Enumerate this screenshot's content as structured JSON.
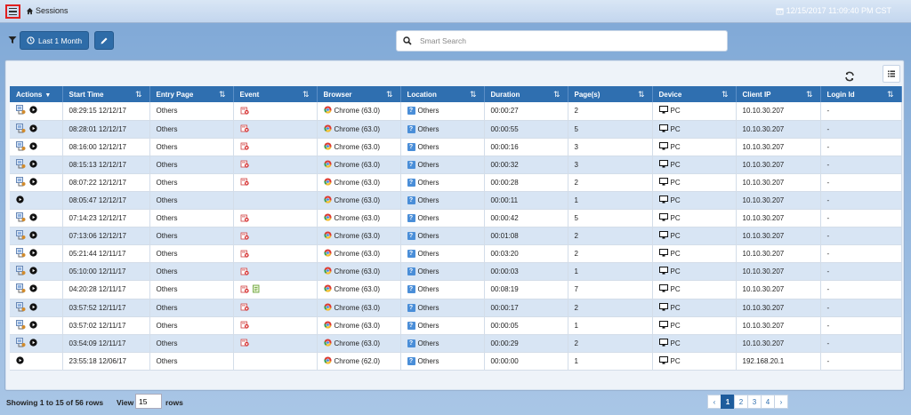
{
  "header": {
    "breadcrumb": "Sessions",
    "datetime": "12/15/2017 11:09:40 PM CST"
  },
  "toolbar": {
    "range_label": "Last 1 Month",
    "search_placeholder": "Smart Search"
  },
  "table": {
    "columns": [
      "Actions",
      "Start Time",
      "Entry Page",
      "Event",
      "Browser",
      "Location",
      "Duration",
      "Page(s)",
      "Device",
      "Client IP",
      "Login Id"
    ],
    "rows": [
      {
        "replay": true,
        "start": "08:29:15 12/12/17",
        "entry": "Others",
        "events": [
          "error"
        ],
        "browser": "Chrome (63.0)",
        "location": "Others",
        "duration": "00:00:27",
        "pages": "2",
        "device": "PC",
        "ip": "10.10.30.207",
        "login": "-"
      },
      {
        "replay": true,
        "start": "08:28:01 12/12/17",
        "entry": "Others",
        "events": [
          "error"
        ],
        "browser": "Chrome (63.0)",
        "location": "Others",
        "duration": "00:00:55",
        "pages": "5",
        "device": "PC",
        "ip": "10.10.30.207",
        "login": "-"
      },
      {
        "replay": true,
        "start": "08:16:00 12/12/17",
        "entry": "Others",
        "events": [
          "error"
        ],
        "browser": "Chrome (63.0)",
        "location": "Others",
        "duration": "00:00:16",
        "pages": "3",
        "device": "PC",
        "ip": "10.10.30.207",
        "login": "-"
      },
      {
        "replay": true,
        "start": "08:15:13 12/12/17",
        "entry": "Others",
        "events": [
          "error"
        ],
        "browser": "Chrome (63.0)",
        "location": "Others",
        "duration": "00:00:32",
        "pages": "3",
        "device": "PC",
        "ip": "10.10.30.207",
        "login": "-"
      },
      {
        "replay": true,
        "start": "08:07:22 12/12/17",
        "entry": "Others",
        "events": [
          "error"
        ],
        "browser": "Chrome (63.0)",
        "location": "Others",
        "duration": "00:00:28",
        "pages": "2",
        "device": "PC",
        "ip": "10.10.30.207",
        "login": "-"
      },
      {
        "replay": false,
        "start": "08:05:47 12/12/17",
        "entry": "Others",
        "events": [],
        "browser": "Chrome (63.0)",
        "location": "Others",
        "duration": "00:00:11",
        "pages": "1",
        "device": "PC",
        "ip": "10.10.30.207",
        "login": "-"
      },
      {
        "replay": true,
        "start": "07:14:23 12/12/17",
        "entry": "Others",
        "events": [
          "error"
        ],
        "browser": "Chrome (63.0)",
        "location": "Others",
        "duration": "00:00:42",
        "pages": "5",
        "device": "PC",
        "ip": "10.10.30.207",
        "login": "-"
      },
      {
        "replay": true,
        "start": "07:13:06 12/12/17",
        "entry": "Others",
        "events": [
          "error"
        ],
        "browser": "Chrome (63.0)",
        "location": "Others",
        "duration": "00:01:08",
        "pages": "2",
        "device": "PC",
        "ip": "10.10.30.207",
        "login": "-"
      },
      {
        "replay": true,
        "start": "05:21:44 12/11/17",
        "entry": "Others",
        "events": [
          "error"
        ],
        "browser": "Chrome (63.0)",
        "location": "Others",
        "duration": "00:03:20",
        "pages": "2",
        "device": "PC",
        "ip": "10.10.30.207",
        "login": "-"
      },
      {
        "replay": true,
        "start": "05:10:00 12/11/17",
        "entry": "Others",
        "events": [
          "error"
        ],
        "browser": "Chrome (63.0)",
        "location": "Others",
        "duration": "00:00:03",
        "pages": "1",
        "device": "PC",
        "ip": "10.10.30.207",
        "login": "-"
      },
      {
        "replay": true,
        "start": "04:20:28 12/11/17",
        "entry": "Others",
        "events": [
          "error",
          "doc"
        ],
        "browser": "Chrome (63.0)",
        "location": "Others",
        "duration": "00:08:19",
        "pages": "7",
        "device": "PC",
        "ip": "10.10.30.207",
        "login": "-"
      },
      {
        "replay": true,
        "start": "03:57:52 12/11/17",
        "entry": "Others",
        "events": [
          "error"
        ],
        "browser": "Chrome (63.0)",
        "location": "Others",
        "duration": "00:00:17",
        "pages": "2",
        "device": "PC",
        "ip": "10.10.30.207",
        "login": "-"
      },
      {
        "replay": true,
        "start": "03:57:02 12/11/17",
        "entry": "Others",
        "events": [
          "error"
        ],
        "browser": "Chrome (63.0)",
        "location": "Others",
        "duration": "00:00:05",
        "pages": "1",
        "device": "PC",
        "ip": "10.10.30.207",
        "login": "-"
      },
      {
        "replay": true,
        "start": "03:54:09 12/11/17",
        "entry": "Others",
        "events": [
          "error"
        ],
        "browser": "Chrome (63.0)",
        "location": "Others",
        "duration": "00:00:29",
        "pages": "2",
        "device": "PC",
        "ip": "10.10.30.207",
        "login": "-"
      },
      {
        "replay": false,
        "start": "23:55:18 12/06/17",
        "entry": "Others",
        "events": [],
        "browser": "Chrome (62.0)",
        "location": "Others",
        "duration": "00:00:00",
        "pages": "1",
        "device": "PC",
        "ip": "192.168.20.1",
        "login": "-"
      }
    ]
  },
  "footer": {
    "showing": "Showing 1 to 15 of 56 rows",
    "view_label": "View",
    "view_value": "15",
    "rows_label": "rows",
    "pages": [
      "‹",
      "1",
      "2",
      "3",
      "4",
      "›"
    ],
    "active_page": "1"
  }
}
